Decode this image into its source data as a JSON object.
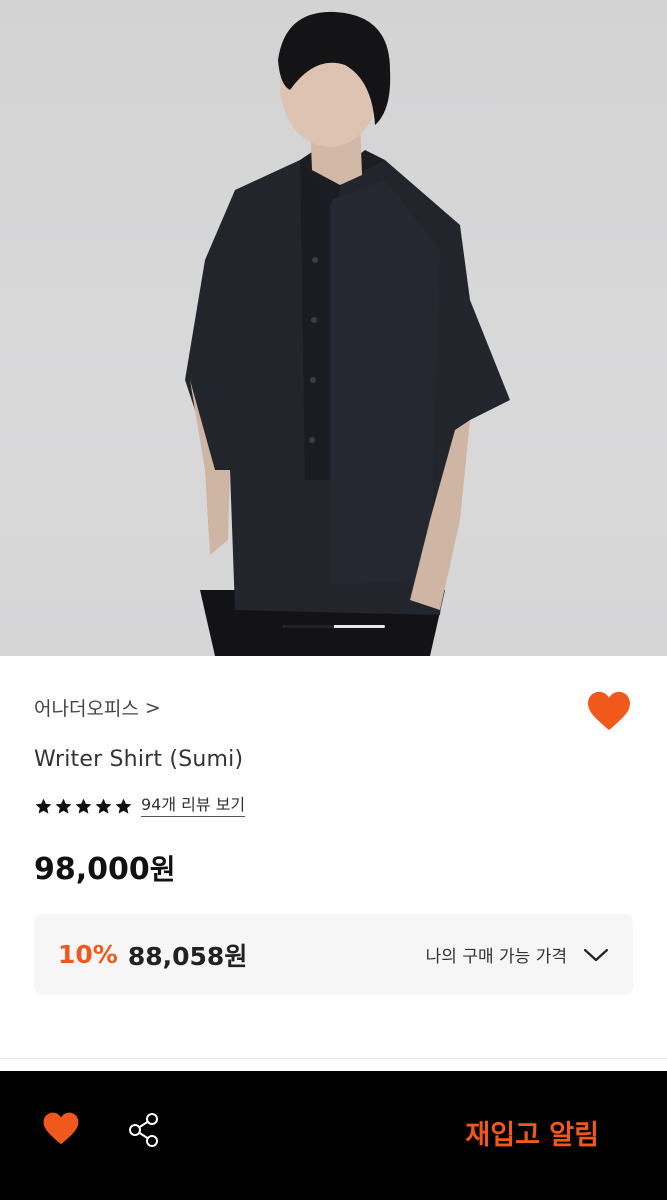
{
  "hero": {
    "carousel": {
      "active_index": 1,
      "total": 2
    }
  },
  "product": {
    "brand": "어나더오피스",
    "brand_chevron": ">",
    "title": "Writer Shirt (Sumi)",
    "rating_stars": 5,
    "review_link": "94개 리뷰 보기",
    "price": "98,000",
    "price_unit": "원"
  },
  "discount": {
    "percent": "10%",
    "price": "88,058원",
    "my_price_label": "나의 구매 가능 가격"
  },
  "bottom_bar": {
    "restock_label": "재입고 알림"
  },
  "colors": {
    "accent": "#f1581c",
    "bar_background": "#000000"
  },
  "icons": [
    "heart-icon",
    "star-icon",
    "chevron-down-icon",
    "share-icon"
  ]
}
